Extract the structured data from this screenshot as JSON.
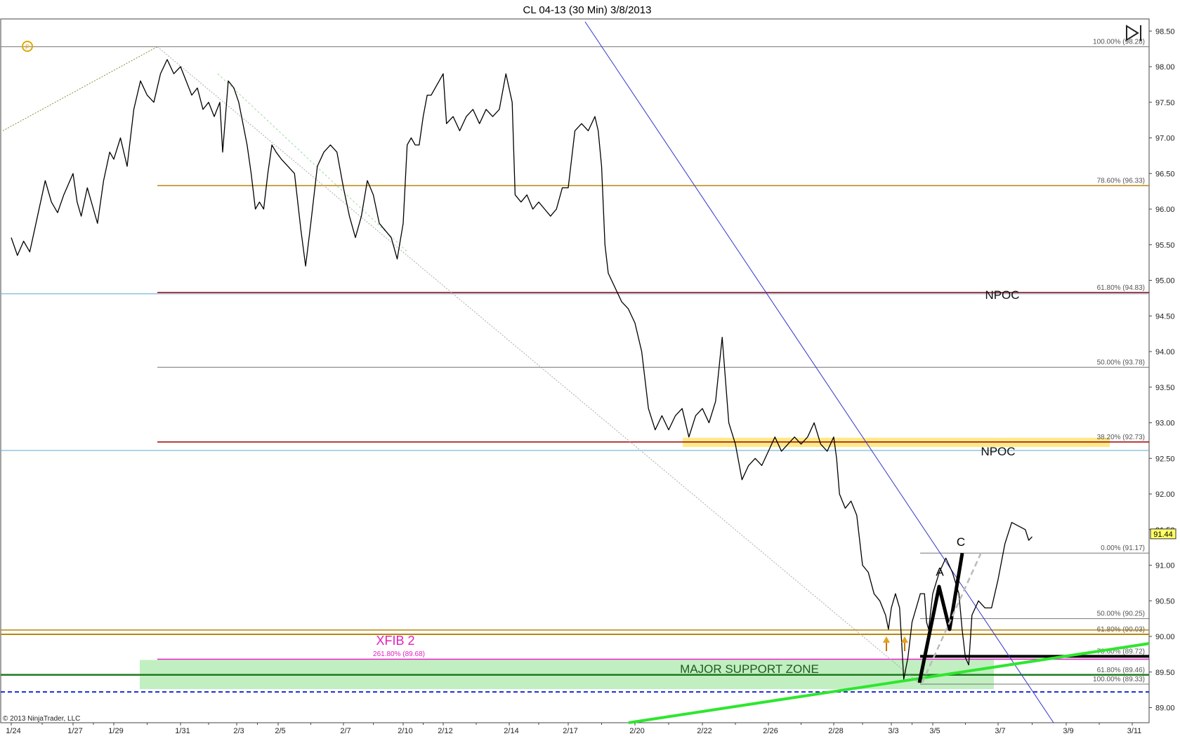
{
  "window": {
    "title": "CL 04-13 (30 Min)  3/8/2013",
    "copyright": "© 2013 NinjaTrader, LLC"
  },
  "colors": {
    "background": "#ffffff",
    "price": "#000000",
    "fib_gold": "#b8860b",
    "fib_red": "#a00000",
    "fib_gray": "#777777",
    "npoc_blue": "#5aa9d6",
    "trendline_blue": "#3333cc",
    "trend_green": "#2ee62e",
    "support_green_line": "#1f7a1f",
    "support_zone": "#b6ecb6",
    "npoc_band": "#ffe87a",
    "xfib": "#e020c0",
    "dashed_blue": "#1a2bd1",
    "price_marker": "#ffff66"
  },
  "icons": {
    "nt_logo": "ninjatrader-logo-icon",
    "scroll_end": "scroll-to-end-icon",
    "arrow_up": "up-arrow-marker-icon"
  },
  "chart_data": {
    "type": "line",
    "title": "CL 04-13 (30 Min)  3/8/2013",
    "xlabel": "",
    "ylabel": "",
    "x_ticks": [
      "1/24",
      "1/27",
      "1/29",
      "1/31",
      "2/3",
      "2/5",
      "2/7",
      "2/10",
      "2/12",
      "2/14",
      "2/17",
      "2/20",
      "2/22",
      "2/26",
      "2/28",
      "3/3",
      "3/5",
      "3/7",
      "3/9",
      "3/11"
    ],
    "y_ticks": [
      98.5,
      98.0,
      97.5,
      97.0,
      96.5,
      96.0,
      95.5,
      95.0,
      94.5,
      94.0,
      93.5,
      93.0,
      92.5,
      92.0,
      91.5,
      91.0,
      90.5,
      90.0,
      89.5,
      89.0
    ],
    "ylim": [
      88.8,
      98.9
    ],
    "xlim": [
      0,
      19.8
    ],
    "grid": false,
    "last_price": "91.44",
    "series": [
      {
        "points": [
          [
            0.0,
            95.6
          ],
          [
            0.1,
            95.35
          ],
          [
            0.2,
            95.55
          ],
          [
            0.3,
            95.4
          ],
          [
            0.4,
            95.8
          ],
          [
            0.55,
            96.4
          ],
          [
            0.65,
            96.1
          ],
          [
            0.75,
            95.95
          ],
          [
            0.85,
            96.2
          ],
          [
            1.0,
            96.5
          ],
          [
            1.1,
            96.1
          ],
          [
            1.2,
            95.9
          ],
          [
            1.35,
            96.3
          ],
          [
            1.5,
            96.0
          ],
          [
            1.6,
            95.8
          ],
          [
            1.75,
            96.4
          ],
          [
            1.9,
            96.8
          ],
          [
            2.0,
            96.7
          ],
          [
            2.1,
            97.0
          ],
          [
            2.2,
            96.6
          ],
          [
            2.3,
            97.4
          ],
          [
            2.4,
            97.8
          ],
          [
            2.5,
            97.6
          ],
          [
            2.6,
            97.5
          ],
          [
            2.7,
            97.9
          ],
          [
            2.8,
            98.1
          ],
          [
            2.9,
            97.9
          ],
          [
            3.0,
            98.0
          ],
          [
            3.1,
            97.8
          ],
          [
            3.2,
            97.6
          ],
          [
            3.3,
            97.7
          ],
          [
            3.4,
            97.4
          ],
          [
            3.5,
            97.5
          ],
          [
            3.6,
            97.3
          ],
          [
            3.7,
            97.5
          ],
          [
            3.75,
            96.8
          ],
          [
            3.85,
            97.8
          ],
          [
            3.95,
            97.7
          ],
          [
            4.05,
            97.5
          ],
          [
            4.15,
            97.2
          ],
          [
            4.25,
            96.9
          ],
          [
            4.35,
            96.5
          ],
          [
            4.45,
            96.0
          ],
          [
            4.55,
            96.1
          ],
          [
            4.65,
            96.0
          ],
          [
            4.75,
            96.5
          ],
          [
            4.85,
            96.9
          ],
          [
            4.95,
            96.8
          ],
          [
            5.05,
            96.7
          ],
          [
            5.15,
            96.6
          ],
          [
            5.25,
            96.5
          ],
          [
            5.35,
            95.7
          ],
          [
            5.42,
            95.2
          ],
          [
            5.5,
            95.8
          ],
          [
            5.6,
            96.6
          ],
          [
            5.7,
            96.8
          ],
          [
            5.8,
            96.9
          ],
          [
            5.9,
            96.8
          ],
          [
            6.0,
            96.3
          ],
          [
            6.1,
            95.9
          ],
          [
            6.2,
            95.6
          ],
          [
            6.3,
            95.9
          ],
          [
            6.4,
            96.4
          ],
          [
            6.5,
            96.2
          ],
          [
            6.6,
            95.8
          ],
          [
            6.7,
            95.7
          ],
          [
            6.8,
            95.6
          ],
          [
            6.9,
            95.3
          ],
          [
            7.0,
            95.8
          ],
          [
            7.1,
            96.9
          ],
          [
            7.2,
            97.0
          ],
          [
            7.3,
            96.9
          ],
          [
            7.4,
            96.9
          ],
          [
            7.5,
            97.3
          ],
          [
            7.6,
            97.6
          ],
          [
            7.7,
            97.6
          ],
          [
            7.8,
            97.7
          ],
          [
            7.9,
            97.8
          ],
          [
            8.0,
            97.9
          ],
          [
            8.05,
            97.2
          ],
          [
            8.15,
            97.3
          ],
          [
            8.25,
            97.1
          ],
          [
            8.35,
            97.3
          ],
          [
            8.45,
            97.4
          ],
          [
            8.55,
            97.2
          ],
          [
            8.65,
            97.4
          ],
          [
            8.75,
            97.3
          ],
          [
            8.85,
            97.4
          ],
          [
            8.95,
            97.9
          ],
          [
            9.05,
            97.5
          ],
          [
            9.1,
            96.2
          ],
          [
            9.2,
            96.1
          ],
          [
            9.3,
            96.2
          ],
          [
            9.4,
            96.0
          ],
          [
            9.5,
            96.1
          ],
          [
            9.6,
            96.0
          ],
          [
            9.7,
            95.9
          ],
          [
            9.8,
            96.0
          ],
          [
            9.9,
            96.3
          ],
          [
            10.0,
            96.3
          ],
          [
            10.1,
            97.1
          ],
          [
            10.2,
            97.2
          ],
          [
            10.3,
            97.1
          ],
          [
            10.4,
            97.3
          ],
          [
            10.45,
            97.1
          ],
          [
            10.5,
            96.6
          ],
          [
            10.55,
            95.5
          ],
          [
            10.6,
            95.1
          ],
          [
            10.7,
            94.9
          ],
          [
            10.8,
            94.7
          ],
          [
            10.9,
            94.6
          ],
          [
            11.0,
            94.4
          ],
          [
            11.1,
            94.0
          ],
          [
            11.2,
            93.2
          ],
          [
            11.3,
            92.9
          ],
          [
            11.4,
            93.1
          ],
          [
            11.5,
            92.9
          ],
          [
            11.6,
            93.1
          ],
          [
            11.7,
            93.2
          ],
          [
            11.8,
            92.8
          ],
          [
            11.9,
            93.1
          ],
          [
            12.0,
            93.2
          ],
          [
            12.1,
            93.0
          ],
          [
            12.2,
            93.3
          ],
          [
            12.3,
            94.2
          ],
          [
            12.4,
            93.0
          ],
          [
            12.5,
            92.7
          ],
          [
            12.6,
            92.2
          ],
          [
            12.7,
            92.4
          ],
          [
            12.8,
            92.5
          ],
          [
            12.9,
            92.4
          ],
          [
            13.0,
            92.6
          ],
          [
            13.1,
            92.8
          ],
          [
            13.2,
            92.6
          ],
          [
            13.3,
            92.7
          ],
          [
            13.4,
            92.8
          ],
          [
            13.5,
            92.7
          ],
          [
            13.6,
            92.8
          ],
          [
            13.7,
            93.0
          ],
          [
            13.8,
            92.7
          ],
          [
            13.9,
            92.6
          ],
          [
            14.0,
            92.8
          ],
          [
            14.05,
            92.5
          ],
          [
            14.1,
            92.0
          ],
          [
            14.2,
            91.8
          ],
          [
            14.3,
            91.9
          ],
          [
            14.4,
            91.7
          ],
          [
            14.5,
            91.0
          ],
          [
            14.6,
            90.9
          ],
          [
            14.7,
            90.6
          ],
          [
            14.8,
            90.5
          ],
          [
            14.9,
            90.3
          ],
          [
            14.95,
            90.1
          ],
          [
            15.0,
            90.4
          ],
          [
            15.1,
            90.6
          ],
          [
            15.2,
            90.4
          ],
          [
            15.25,
            89.9
          ],
          [
            15.3,
            89.4
          ],
          [
            15.4,
            89.7
          ],
          [
            15.5,
            90.2
          ],
          [
            15.6,
            90.4
          ],
          [
            15.7,
            90.6
          ],
          [
            15.8,
            90.6
          ],
          [
            15.85,
            90.2
          ],
          [
            15.9,
            90.1
          ],
          [
            16.0,
            90.6
          ],
          [
            16.1,
            90.9
          ],
          [
            16.2,
            91.1
          ],
          [
            16.3,
            90.9
          ],
          [
            16.4,
            90.6
          ],
          [
            16.45,
            90.1
          ],
          [
            16.5,
            89.7
          ],
          [
            16.55,
            89.6
          ],
          [
            16.6,
            90.3
          ],
          [
            16.7,
            90.5
          ],
          [
            16.8,
            90.4
          ],
          [
            16.9,
            90.4
          ],
          [
            17.0,
            90.8
          ],
          [
            17.1,
            91.3
          ],
          [
            17.2,
            91.6
          ],
          [
            17.3,
            91.55
          ],
          [
            17.4,
            91.5
          ],
          [
            17.45,
            91.35
          ],
          [
            17.5,
            91.4
          ]
        ]
      }
    ],
    "levels": [
      {
        "label": "100.00% (98.28)",
        "value": 98.28
      },
      {
        "label": "78.60% (96.33)",
        "value": 96.33
      },
      {
        "label": "61.80% (94.83)",
        "value": 94.83
      },
      {
        "label": "50.00% (93.78)",
        "value": 93.78
      },
      {
        "label": "38.20% (92.73)",
        "value": 92.73
      },
      {
        "label": "0.00% (91.17)",
        "value": 91.17
      },
      {
        "label": "50.00% (90.25)",
        "value": 90.25
      },
      {
        "label": "61.80% (90.03)",
        "value": 90.03
      },
      {
        "label": "78.60% (89.72)",
        "value": 89.72
      },
      {
        "label": "61.80% (89.46)",
        "value": 89.46
      },
      {
        "label": "100.00% (89.33)",
        "value": 89.33
      }
    ],
    "annotations": {
      "npoc_upper": "NPOC",
      "npoc_lower": "NPOC",
      "xfib_title": "XFIB 2",
      "xfib_level": "261.80% (89.68)",
      "support_zone": "MAJOR SUPPORT ZONE",
      "wave_a": "A",
      "wave_c": "C"
    }
  }
}
